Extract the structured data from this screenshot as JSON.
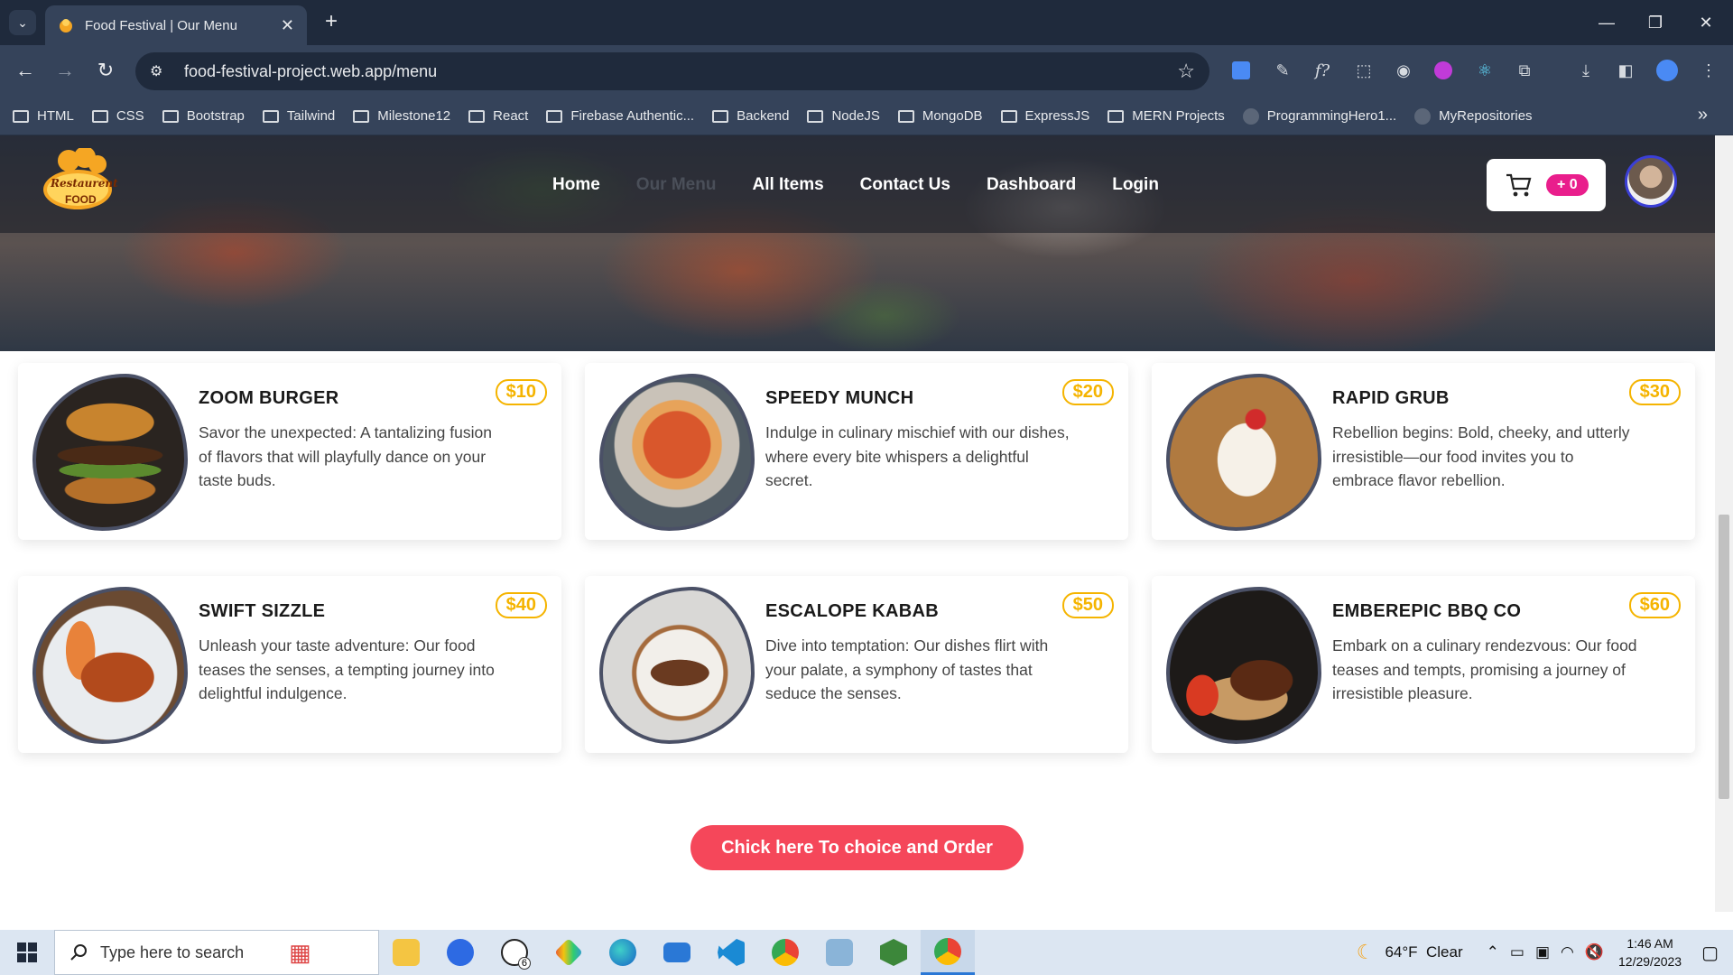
{
  "browser": {
    "tab_title": "Food Festival | Our Menu",
    "url": "food-festival-project.web.app/menu",
    "bookmarks": [
      "HTML",
      "CSS",
      "Bootstrap",
      "Tailwind",
      "Milestone12",
      "React",
      "Firebase Authentic...",
      "Backend",
      "NodeJS",
      "MongoDB",
      "ExpressJS",
      "MERN Projects",
      "ProgrammingHero1...",
      "MyRepositories"
    ]
  },
  "site": {
    "logo_line1": "Restaurent",
    "logo_line2": "FOOD",
    "nav": [
      "Home",
      "Our Menu",
      "All Items",
      "Contact Us",
      "Dashboard",
      "Login"
    ],
    "cart_count": "+ 0"
  },
  "menu": [
    {
      "name": "ZOOM BURGER",
      "price": "$10",
      "desc": "Savor the unexpected: A tantalizing fusion of flavors that will playfully dance on your taste buds."
    },
    {
      "name": "SPEEDY MUNCH",
      "price": "$20",
      "desc": "Indulge in culinary mischief with our dishes, where every bite whispers a delightful secret."
    },
    {
      "name": "RAPID GRUB",
      "price": "$30",
      "desc": "Rebellion begins: Bold, cheeky, and utterly irresistible—our food invites you to embrace flavor rebellion."
    },
    {
      "name": "SWIFT SIZZLE",
      "price": "$40",
      "desc": "Unleash your taste adventure: Our food teases the senses, a tempting journey into delightful indulgence."
    },
    {
      "name": "ESCALOPE KABAB",
      "price": "$50",
      "desc": "Dive into temptation: Our dishes flirt with your palate, a symphony of tastes that seduce the senses."
    },
    {
      "name": "EMBEREPIC BBQ CO",
      "price": "$60",
      "desc": "Embark on a culinary rendezvous: Our food teases and tempts, promising a journey of irresistible pleasure."
    }
  ],
  "order_button": "Chick here To choice and Order",
  "taskbar": {
    "search_placeholder": "Type here to search",
    "whatsapp_badge": "6",
    "weather": "64°F  Clear",
    "time": "1:46 AM",
    "date": "12/29/2023"
  }
}
